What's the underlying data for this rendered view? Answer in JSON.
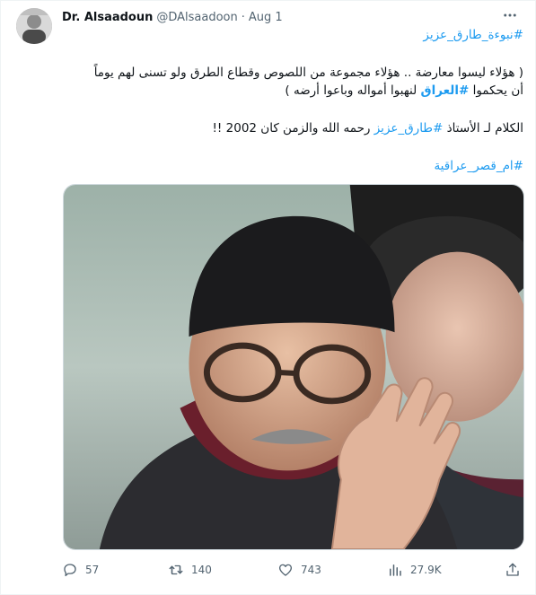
{
  "author": {
    "display_name": "Dr. Alsaadoun",
    "handle": "@DAlsaadoon",
    "separator": "·",
    "date": "Aug 1",
    "avatar_icon": "profile-photo"
  },
  "tweet": {
    "hashtag_top": "#نبوءة_طارق_عزيز",
    "line1": "( هؤلاء ليسوا معارضة .. هؤلاء مجموعة من اللصوص وقطاع الطرق ولو تسنى لهم يوماً",
    "line2_before": "أن يحكموا ",
    "line2_hashtag": "#العراق",
    "line2_after": " لنهبوا أمواله وباعوا أرضه )",
    "line3_before": "الكلام لـ الأستاذ ",
    "line3_hashtag": "#طارق_عزيز",
    "line3_after": " رحمه الله والزمن كان 2002 !!",
    "hashtag_bottom": "#ام_قصر_عراقية"
  },
  "actions": {
    "replies": "57",
    "retweets": "140",
    "likes": "743",
    "views": "27.9K"
  },
  "colors": {
    "link": "#1d9bf0",
    "muted": "#536471",
    "text": "#0f1419"
  }
}
